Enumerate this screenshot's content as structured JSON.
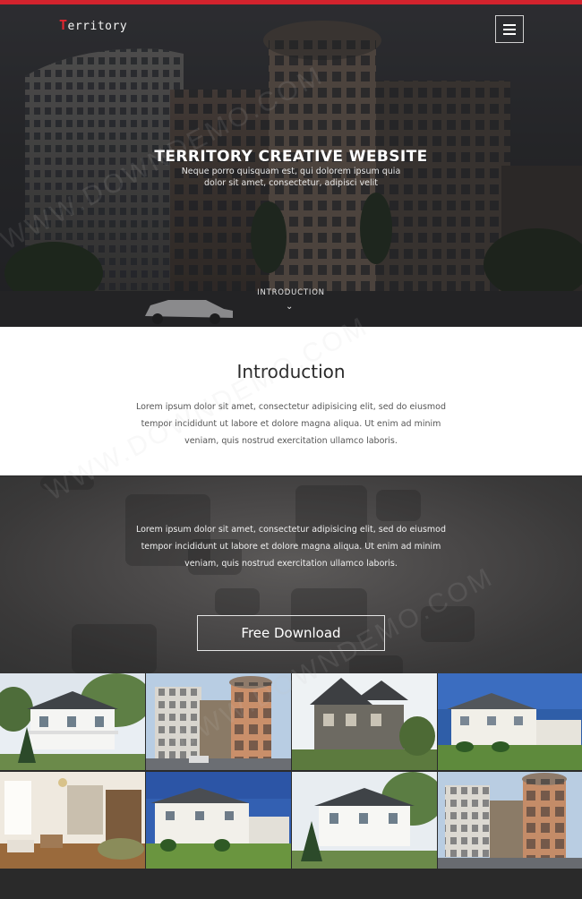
{
  "colors": {
    "accent": "#d3232d",
    "dark_section": "#4a4848",
    "white": "#ffffff"
  },
  "nav": {
    "brand_initial": "T",
    "brand_rest": "erritory",
    "menu_icon": "hamburger-icon"
  },
  "hero": {
    "title": "TERRITORY CREATIVE WEBSITE",
    "subtitle": "Neque porro quisquam est, qui dolorem ipsum quia dolor sit amet, consectetur, adipisci velit",
    "scroll_link": "INTRODUCTION",
    "scroll_icon": "chevron-down-icon"
  },
  "intro": {
    "heading": "Introduction",
    "body": "Lorem ipsum dolor sit amet, consectetur adipisicing elit, sed do eiusmod tempor incididunt ut labore et dolore magna aliqua. Ut enim ad minim veniam, quis nostrud exercitation ullamco laboris."
  },
  "promo": {
    "body": "Lorem ipsum dolor sit amet, consectetur adipisicing elit, sed do eiusmod tempor incididunt ut labore et dolore magna aliqua. Ut enim ad minim veniam, quis nostrud exercitation ullamco laboris.",
    "button_label": "Free Download"
  },
  "gallery": {
    "items": [
      {
        "subject": "white-house-porch"
      },
      {
        "subject": "modern-tower"
      },
      {
        "subject": "grey-gabled-house"
      },
      {
        "subject": "suburban-house-blue-sky"
      },
      {
        "subject": "living-room-interior"
      },
      {
        "subject": "green-lawn-house"
      },
      {
        "subject": "white-house-porch"
      },
      {
        "subject": "modern-tower"
      }
    ]
  },
  "watermark": "WWW.DOWNDEMO.COM"
}
